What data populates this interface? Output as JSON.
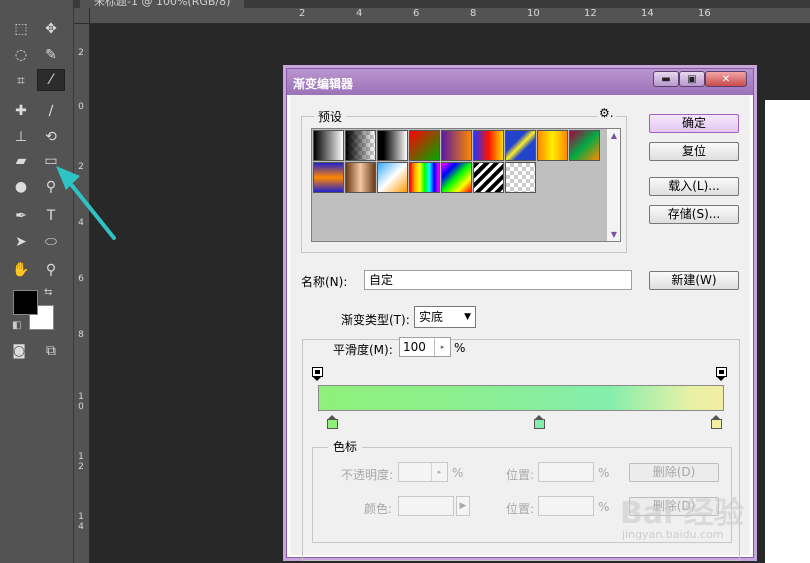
{
  "document_tab": {
    "title": "未标题-1 @ 100%(RGB/8)"
  },
  "rulers": {
    "top_ticks": [
      "2",
      "4",
      "6",
      "8",
      "10",
      "12",
      "14",
      "16"
    ],
    "left_ticks": [
      "2",
      "0",
      "2",
      "4",
      "6",
      "8",
      "1\n0",
      "1\n2",
      "1\n4"
    ]
  },
  "toolbar": {
    "items": [
      {
        "name": "marquee-tool",
        "icon": "marquee-icon",
        "glyph": "⬚"
      },
      {
        "name": "move-tool",
        "icon": "move-icon",
        "glyph": "✥"
      },
      {
        "name": "lasso-tool",
        "icon": "lasso-icon",
        "glyph": "◌"
      },
      {
        "name": "quick-select-tool",
        "icon": "quick-select-icon",
        "glyph": "✎"
      },
      {
        "name": "crop-tool",
        "icon": "crop-icon",
        "glyph": "⌗"
      },
      {
        "name": "eyedropper-tool",
        "icon": "eyedropper-icon",
        "glyph": "⁄"
      },
      {
        "name": "healing-tool",
        "icon": "bandage-icon",
        "glyph": "✚"
      },
      {
        "name": "brush-tool",
        "icon": "brush-icon",
        "glyph": "∕"
      },
      {
        "name": "stamp-tool",
        "icon": "stamp-icon",
        "glyph": "⊥"
      },
      {
        "name": "history-brush-tool",
        "icon": "history-brush-icon",
        "glyph": "⟲"
      },
      {
        "name": "eraser-tool",
        "icon": "eraser-icon",
        "glyph": "▰"
      },
      {
        "name": "gradient-tool",
        "icon": "gradient-icon",
        "glyph": "▭"
      },
      {
        "name": "blur-tool",
        "icon": "drop-icon",
        "glyph": "●"
      },
      {
        "name": "dodge-tool",
        "icon": "dodge-icon",
        "glyph": "⚲"
      },
      {
        "name": "pen-tool",
        "icon": "pen-icon",
        "glyph": "✒"
      },
      {
        "name": "type-tool",
        "icon": "type-icon",
        "glyph": "T"
      },
      {
        "name": "path-select-tool",
        "icon": "arrow-icon",
        "glyph": "➤"
      },
      {
        "name": "shape-tool",
        "icon": "ellipse-icon",
        "glyph": "⬭"
      },
      {
        "name": "hand-tool",
        "icon": "hand-icon",
        "glyph": "✋"
      },
      {
        "name": "zoom-tool",
        "icon": "zoom-icon",
        "glyph": "⚲"
      }
    ]
  },
  "dialog": {
    "title": "渐变编辑器",
    "presets": {
      "label": "预设",
      "gear": "⚙."
    },
    "buttons": {
      "ok": "确定",
      "reset": "复位",
      "load": "载入(L)...",
      "save": "存储(S)...",
      "new": "新建(W)"
    },
    "name_label": "名称(N):",
    "name_value": "自定",
    "gradient_type_label": "渐变类型(T):",
    "gradient_type_value": "实底",
    "smoothness_label": "平滑度(M):",
    "smoothness_value": "100",
    "percent": "%",
    "stops": {
      "legend": "色标",
      "opacity_label": "不透明度:",
      "location_label": "位置:",
      "delete_label": "删除(D)",
      "color_label": "颜色:"
    },
    "colors": {
      "gradient_start": "#8ff07a",
      "gradient_mid": "#84eeac",
      "gradient_end": "#f4eda4",
      "title_bar": "#a77fc0"
    }
  },
  "watermark": {
    "brand": "Bai 经验",
    "url": "jingyan.baidu.com"
  }
}
